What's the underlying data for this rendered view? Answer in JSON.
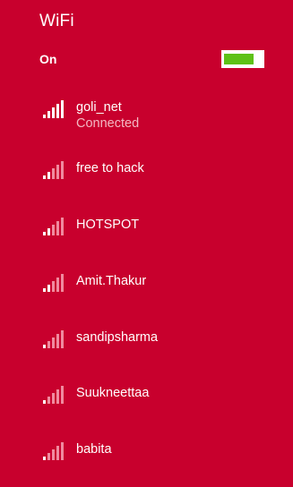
{
  "panel": {
    "title": "WiFi",
    "wifi_label": "On",
    "wifi_enabled": true
  },
  "colors": {
    "background": "#c8002d",
    "toggle_on": "#5ec117",
    "bar_strong": "#ffffff",
    "bar_weak": "#f08a9f",
    "status_text": "#f3b8c3"
  },
  "networks": [
    {
      "name": "goli_net",
      "status": "Connected",
      "signal_bars": 5
    },
    {
      "name": "free to hack",
      "status": "",
      "signal_bars": 2
    },
    {
      "name": "HOTSPOT",
      "status": "",
      "signal_bars": 2
    },
    {
      "name": "Amit.Thakur",
      "status": "",
      "signal_bars": 2
    },
    {
      "name": "sandipsharma",
      "status": "",
      "signal_bars": 1
    },
    {
      "name": "Suukneettaa",
      "status": "",
      "signal_bars": 1
    },
    {
      "name": "babita",
      "status": "",
      "signal_bars": 1
    }
  ]
}
